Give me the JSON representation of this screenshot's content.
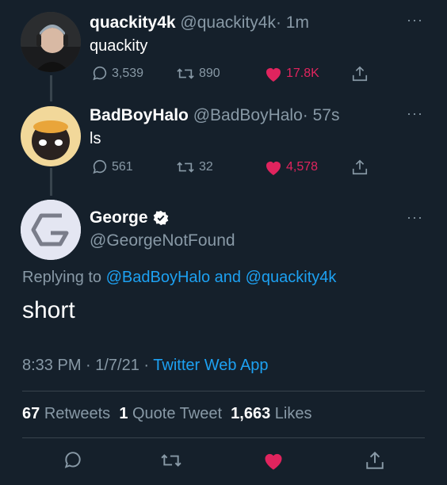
{
  "tweets": [
    {
      "name": "quackity4k",
      "handle": "@quackity4k",
      "time": "· 1m",
      "text": "quackity",
      "replies": "3,539",
      "retweets": "890",
      "likes": "17.8K",
      "avatar_icon": "person-with-headset-avatar"
    },
    {
      "name": "BadBoyHalo",
      "handle": "@BadBoyHalo",
      "time": "· 57s",
      "text": "ls",
      "replies": "561",
      "retweets": "32",
      "likes": "4,578",
      "avatar_icon": "cartoon-halo-avatar"
    }
  ],
  "main_tweet": {
    "name": "George",
    "handle": "@GeorgeNotFound",
    "verified_icon": "verified-badge-icon",
    "replying_to_label": "Replying to",
    "replying_to_user1": "@BadBoyHalo",
    "replying_and": "and",
    "replying_to_user2": "@quackity4k",
    "text": "short",
    "time": "8:33 PM · 1/7/21 ·",
    "source": "Twitter Web App",
    "stats": {
      "retweets_count": "67",
      "retweets_label": "Retweets",
      "quotes_count": "1",
      "quotes_label": "Quote Tweet",
      "likes_count": "1,663",
      "likes_label": "Likes"
    }
  },
  "more_label": "···",
  "colors": {
    "background": "#15202b",
    "text": "#ffffff",
    "muted": "#8899a6",
    "link": "#1da1f2",
    "like": "#e0245e",
    "divider": "#38444d"
  }
}
